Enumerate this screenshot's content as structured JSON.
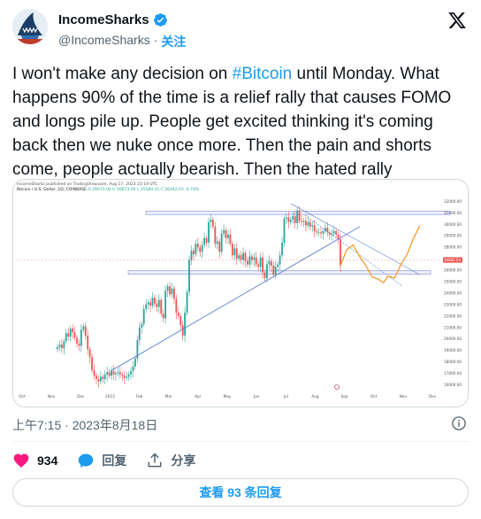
{
  "author": {
    "name": "IncomeSharks",
    "handle": "@IncomeSharks",
    "separator": "·",
    "follow_label": "关注",
    "verified": true
  },
  "tweet": {
    "text_before": "I won't make any decision on ",
    "hashtag": "#Bitcoin",
    "text_after": " until Monday. What happens 90% of the time is a relief rally that causes FOMO and longs pile up. People get excited thinking it's coming back then we nuke once more. Then the pain and shorts come, people actually bearish. Then the hated rally",
    "timestamp": "上午7:15 · 2023年8月18日"
  },
  "chart": {
    "header_line1": "IncomeSharks published on TradingView.com, Aug 17, 2023 23:19 UTC",
    "header_symbol": "Bitcoin / U.S. Dollar, 1D, COINBASE",
    "header_values": "O 26673.00  H 26673.00  L 25184.31  C 26442.03  -0.74%"
  },
  "chart_data": {
    "type": "candlestick",
    "x_ticks": [
      "Oct",
      "Nov",
      "Dec",
      "2023",
      "Feb",
      "Mar",
      "Apr",
      "May",
      "Jun",
      "Jul",
      "Aug",
      "Sep",
      "Oct",
      "Nov",
      "Dec"
    ],
    "y_ticks": [
      "32000.00",
      "31000.00",
      "30000.00",
      "29000.00",
      "28000.00",
      "27000.00",
      "26000.00",
      "25000.00",
      "24000.00",
      "23000.00",
      "22000.00",
      "21000.00",
      "20000.00",
      "19000.00",
      "18000.00",
      "17000.00",
      "16000.00"
    ],
    "ylim": [
      15500,
      32800
    ],
    "price_label": "26882.03",
    "closes": [
      19300,
      19500,
      19200,
      19800,
      20500,
      20200,
      20900,
      20600,
      20100,
      19600,
      19400,
      20800,
      21100,
      20300,
      19100,
      18400,
      17300,
      16800,
      16500,
      16300,
      16700,
      16500,
      16900,
      17100,
      16800,
      17200,
      16900,
      17000,
      17100,
      16900,
      16800,
      16600,
      16700,
      16900,
      17200,
      17600,
      18300,
      19900,
      21000,
      21300,
      22600,
      23000,
      23200,
      22900,
      23600,
      23100,
      22800,
      23400,
      22200,
      21800,
      24200,
      24600,
      23900,
      24400,
      23500,
      22300,
      22000,
      21200,
      20300,
      22300,
      24100,
      26900,
      27700,
      27400,
      28300,
      28000,
      27600,
      28200,
      28800,
      28400,
      30200,
      30400,
      29800,
      28300,
      28500,
      27600,
      29200,
      29500,
      28800,
      29100,
      28300,
      27300,
      27900,
      27000,
      27300,
      26900,
      27500,
      26800,
      26500,
      27200,
      26900,
      27100,
      26500,
      26300,
      27100,
      25800,
      25300,
      26500,
      26800,
      26400,
      25600,
      26300,
      26500,
      27300,
      28400,
      30500,
      30600,
      30200,
      30400,
      30700,
      30100,
      31200,
      30300,
      30200,
      30300,
      29900,
      30200,
      29800,
      29900,
      29400,
      29300,
      29300,
      29200,
      29400,
      29700,
      29300,
      29100,
      29200,
      29400,
      29100,
      28700,
      26400
    ],
    "projection": [
      [
        0,
        26400
      ],
      [
        4,
        27800
      ],
      [
        8,
        28200
      ],
      [
        12,
        27200
      ],
      [
        16,
        26400
      ],
      [
        20,
        25400
      ],
      [
        24,
        25200
      ],
      [
        27,
        24900
      ],
      [
        30,
        25500
      ],
      [
        34,
        25300
      ],
      [
        38,
        26500
      ],
      [
        42,
        27400
      ],
      [
        46,
        28800
      ],
      [
        50,
        29900
      ]
    ],
    "resistance_band": [
      30850,
      31150
    ],
    "support_band": [
      25650,
      25950
    ],
    "uptrend_line": [
      [
        0,
        17200
      ],
      [
        1,
        29800
      ]
    ],
    "channel_lines": [
      [
        31800,
        25600
      ],
      [
        30800,
        24600
      ]
    ],
    "colors": {
      "up": "#26a69a",
      "down": "#ef5350",
      "trend": "#5b7fd0",
      "projection": "#f7931a",
      "band": "#9aa5e0"
    }
  },
  "engagement": {
    "likes": "934",
    "reply_label": "回复",
    "share_label": "分享",
    "view_replies": "查看 93 条回复"
  },
  "colors": {
    "accent": "#1d9bf0",
    "like": "#f91880",
    "text": "#0f1419",
    "muted": "#536471"
  }
}
